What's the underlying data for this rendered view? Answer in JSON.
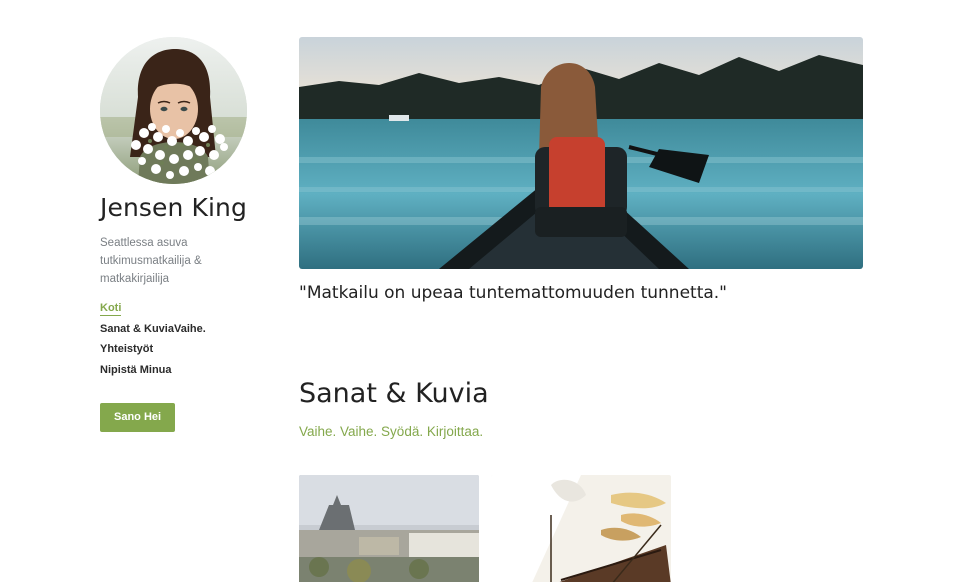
{
  "profile": {
    "name": "Jensen King",
    "bio": "Seattlessa asuva tutkimusmatkailija & matkakirjailija"
  },
  "nav": {
    "items": [
      {
        "label": "Koti",
        "active": true
      },
      {
        "label": "Sanat & KuviaVaihe.",
        "active": false
      },
      {
        "label": "Yhteistyöt",
        "active": false
      },
      {
        "label": "Nipistä Minua",
        "active": false
      }
    ]
  },
  "cta": {
    "label": "Sano Hei"
  },
  "hero": {
    "quote": "\"Matkailu on upeaa tuntemattomuuden tunnetta.\""
  },
  "section": {
    "title": "Sanat & Kuvia",
    "subtitle": "Vaihe. Vaihe. Syödä. Kirjoittaa."
  },
  "colors": {
    "accent": "#84a84c",
    "text": "#222222",
    "muted": "#7a7f84"
  },
  "icons": {
    "avatar": "portrait-photo",
    "hero": "canoe-lake-photo",
    "thumb1": "paris-city-photo",
    "thumb2": "flags-mast-photo"
  }
}
